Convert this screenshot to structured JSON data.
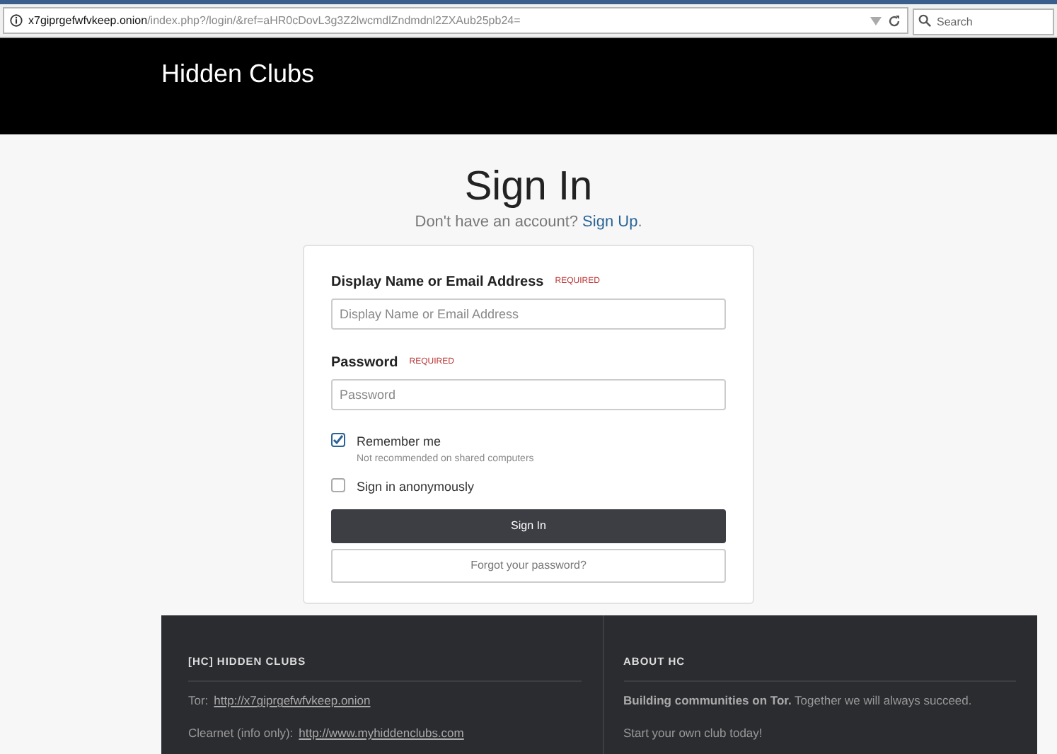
{
  "browser": {
    "url_host": "x7giprgefwfvkeep.onion",
    "url_path": "/index.php?/login/&ref=aHR0cDovL3g3Z2lwcmdlZndmdnl2ZXAub25pb24=",
    "search_placeholder": "Search"
  },
  "header": {
    "site_title": "Hidden Clubs"
  },
  "signin": {
    "title": "Sign In",
    "prompt": "Don't have an account?",
    "signup_link": "Sign Up",
    "prompt_end": ".",
    "fields": [
      {
        "label": "Display Name or Email Address",
        "required_tag": "REQUIRED",
        "placeholder": "Display Name or Email Address"
      },
      {
        "label": "Password",
        "required_tag": "REQUIRED",
        "placeholder": "Password"
      }
    ],
    "options": [
      {
        "label": "Remember me",
        "hint": "Not recommended on shared computers",
        "checked": true
      },
      {
        "label": "Sign in anonymously",
        "checked": false
      }
    ],
    "submit": "Sign In",
    "forgot": "Forgot your password?"
  },
  "footer": {
    "columns": [
      {
        "heading": "[HC] HIDDEN CLUBS",
        "lines": [
          {
            "text": "Tor:",
            "link": "http://x7giprgefwfvkeep.onion"
          },
          {
            "text": "Clearnet (info only):",
            "link": "http://www.myhiddenclubs.com"
          }
        ]
      },
      {
        "heading": "ABOUT HC",
        "lines": [
          {
            "text": "**Building communities on Tor.** Together we will always succeed."
          },
          {
            "text": "Start your own club today!"
          }
        ]
      }
    ]
  }
}
